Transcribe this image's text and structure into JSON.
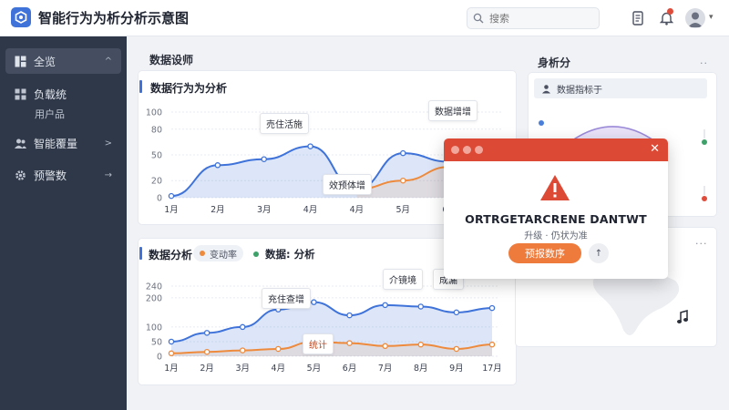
{
  "app": {
    "title": "智能行为为析分析示意图"
  },
  "search": {
    "placeholder": "搜索"
  },
  "colors": {
    "accent": "#3f73d9",
    "orange": "#ee8a3c",
    "alert": "#dc4a36",
    "sidebar": "#2f3848"
  },
  "sidebar": {
    "items": [
      {
        "label": "全览",
        "icon": "dashboard-icon",
        "arrow": "^"
      },
      {
        "label": "负载统",
        "icon": "grid-icon",
        "arrow": ""
      },
      {
        "label": "智能覆量",
        "icon": "users-icon",
        "arrow": ">"
      },
      {
        "label": "预警数",
        "icon": "gear-icon",
        "arrow": "→"
      }
    ],
    "sub_item": "用户品"
  },
  "main": {
    "section_title": "数据设师",
    "card1": {
      "title": "数据行为为分析",
      "tooltips": [
        "売住活施",
        "数据增增",
        "效预体增"
      ]
    },
    "card2": {
      "title": "数据分析",
      "chip": "变动率",
      "legend": "数据: 分析",
      "tooltips": [
        "充住查增",
        "介镜境",
        "统计",
        "成漏"
      ]
    }
  },
  "right_panel": {
    "title": "身析分",
    "dots": "..",
    "row_label": "数据指标于",
    "dots2": "..."
  },
  "modal": {
    "title": "ORTRGETARCRENE DANTWT",
    "subtitle": "升级 · 仍状为准",
    "primary": "预报数序",
    "secondary": "↑"
  },
  "chart_data": [
    {
      "type": "line",
      "x": [
        "1月",
        "2月",
        "3月",
        "4月",
        "4月",
        "5月",
        "6月",
        "7月"
      ],
      "ylim": [
        0,
        100
      ],
      "yticks": [
        0,
        20,
        50,
        80,
        100
      ],
      "series": [
        {
          "values": [
            2,
            38,
            45,
            60,
            10,
            52,
            42,
            47
          ]
        },
        {
          "values": [
            null,
            null,
            null,
            null,
            10,
            20,
            36,
            47
          ]
        }
      ]
    },
    {
      "type": "line",
      "x": [
        "1月",
        "2月",
        "3月",
        "4月",
        "5月",
        "6月",
        "7月",
        "8月",
        "9月",
        "17月"
      ],
      "ylim": [
        0,
        240
      ],
      "yticks": [
        0,
        50,
        100,
        200,
        240
      ],
      "series": [
        {
          "values": [
            50,
            80,
            100,
            160,
            185,
            140,
            175,
            170,
            150,
            165
          ]
        },
        {
          "values": [
            10,
            15,
            20,
            25,
            50,
            45,
            35,
            40,
            25,
            40
          ]
        }
      ]
    }
  ]
}
